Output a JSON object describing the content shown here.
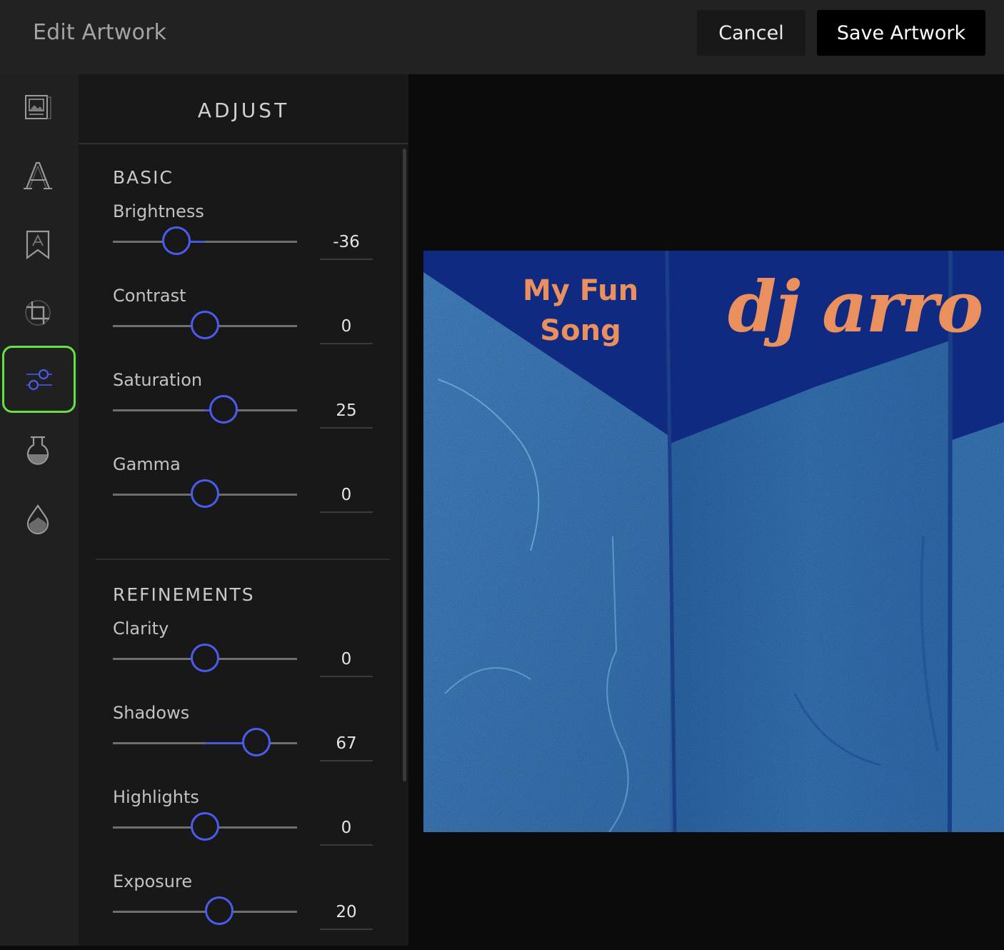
{
  "header": {
    "title": "Edit Artwork",
    "cancel_label": "Cancel",
    "save_label": "Save Artwork"
  },
  "toolbar": {
    "tools": [
      {
        "name": "image-icon"
      },
      {
        "name": "text-icon"
      },
      {
        "name": "sticker-icon"
      },
      {
        "name": "crop-icon"
      },
      {
        "name": "adjust-icon",
        "active": true
      },
      {
        "name": "filter-icon"
      },
      {
        "name": "color-drop-icon"
      }
    ]
  },
  "panel": {
    "title": "ADJUST",
    "basic": {
      "heading": "BASIC",
      "brightness": {
        "label": "Brightness",
        "value": "-36"
      },
      "contrast": {
        "label": "Contrast",
        "value": "0"
      },
      "saturation": {
        "label": "Saturation",
        "value": "25"
      },
      "gamma": {
        "label": "Gamma",
        "value": "0"
      }
    },
    "refinements": {
      "heading": "REFINEMENTS",
      "clarity": {
        "label": "Clarity",
        "value": "0"
      },
      "shadows": {
        "label": "Shadows",
        "value": "67"
      },
      "highlights": {
        "label": "Highlights",
        "value": "0"
      },
      "exposure": {
        "label": "Exposure",
        "value": "20"
      }
    }
  },
  "artwork": {
    "song_title": "My Fun Song",
    "artist": "dj arro"
  },
  "colors": {
    "accent": "#4a5cf0",
    "active_tool_border": "#67e043",
    "art_text": "#e9905e",
    "wall_blue": "#3e7fc4",
    "shadow_blue": "#0f2a80"
  }
}
